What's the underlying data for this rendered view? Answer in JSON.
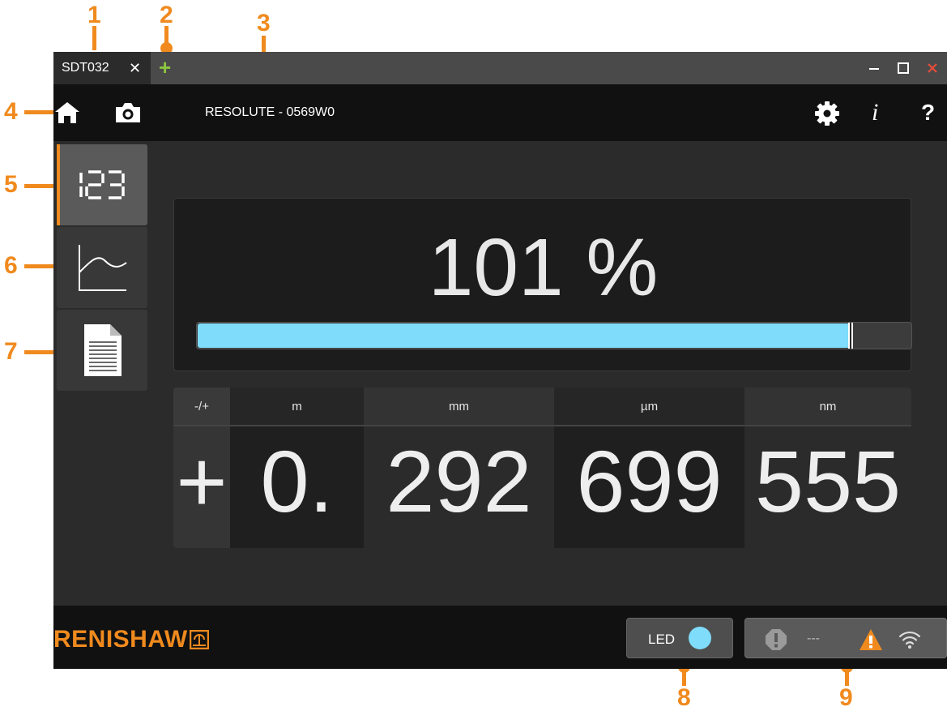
{
  "callouts": [
    "1",
    "2",
    "3",
    "4",
    "5",
    "6",
    "7",
    "8",
    "9"
  ],
  "tabs": [
    {
      "label": "SDT032",
      "close_icon": "close-icon",
      "active": true
    }
  ],
  "new_tab_icon": "plus-icon",
  "toolbar": {
    "device_title": "RESOLUTE - 0569W0",
    "info_label": "i",
    "help_label": "?"
  },
  "nav": [
    {
      "id": "digital-readout",
      "icon": "digits-123-icon",
      "active": true
    },
    {
      "id": "graph",
      "icon": "graph-icon",
      "active": false
    },
    {
      "id": "report",
      "icon": "document-icon",
      "active": false
    }
  ],
  "signal": {
    "value_text": "101 %",
    "bar_fill_fraction": 0.912,
    "marker_fraction": 0.914,
    "bar_color": "#7fdcfa"
  },
  "readout": {
    "headers": {
      "sign": "-/+",
      "m": "m",
      "mm": "mm",
      "um": "µm",
      "nm": "nm"
    },
    "values": {
      "sign": "+",
      "m": "0.",
      "mm": "292",
      "um": "699",
      "nm": "555"
    }
  },
  "footer": {
    "logo_text": "RENISHAW",
    "led_label": "LED",
    "led_color": "#7fdcfa",
    "status_text": "---"
  },
  "colors": {
    "accent": "#f08a1e",
    "new_tab": "#8cc63f",
    "close": "#e74c3c"
  }
}
